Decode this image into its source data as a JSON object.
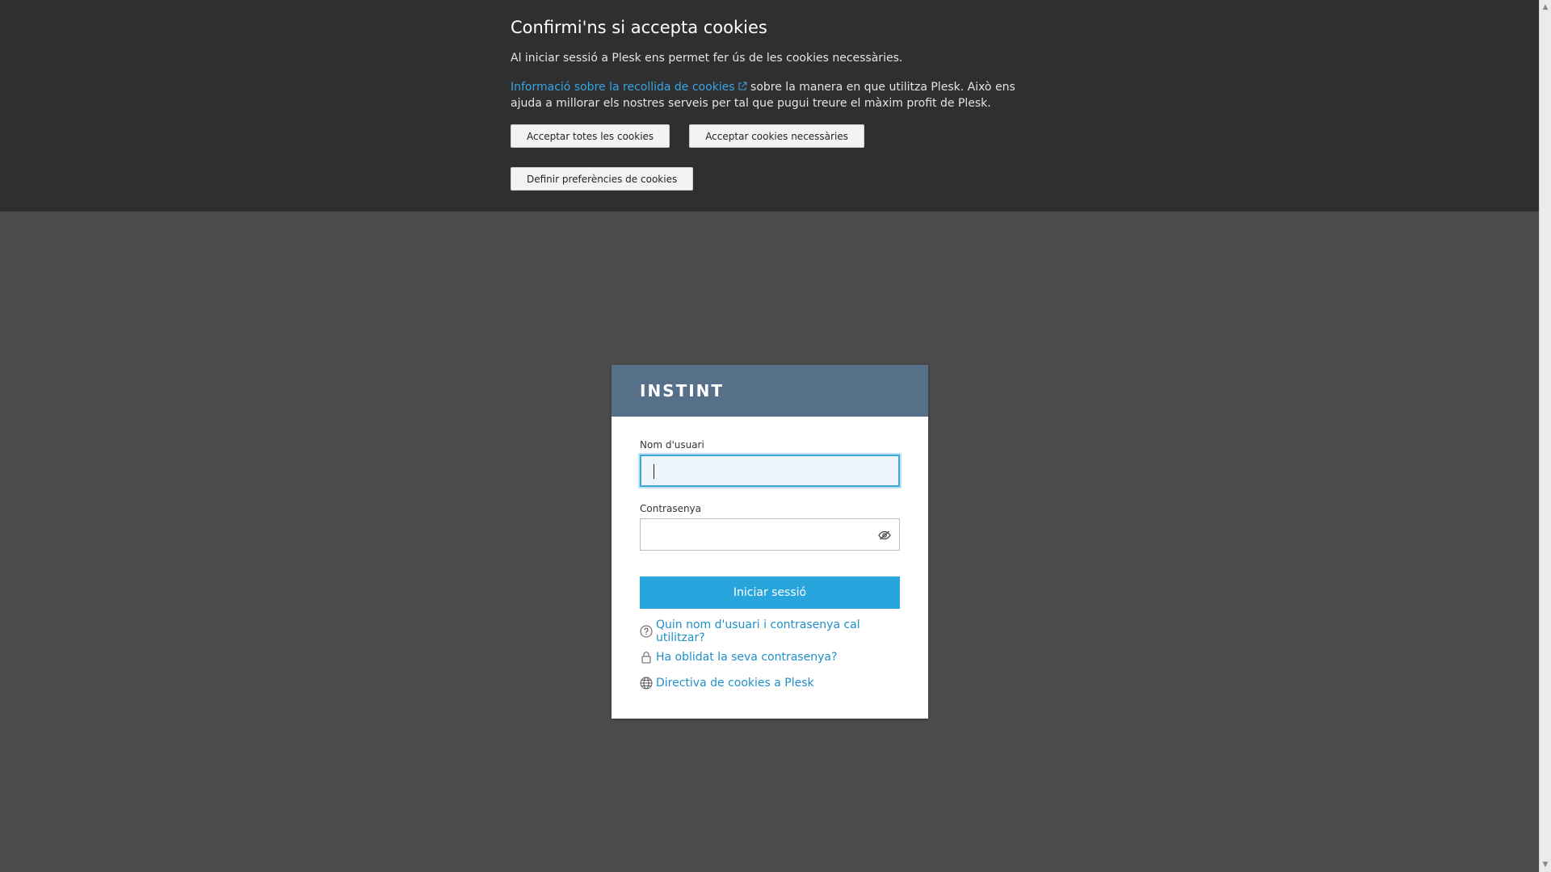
{
  "cookie_banner": {
    "title": "Confirmi'ns si accepta cookies",
    "intro": "Al iniciar sessió a Plesk ens permet fer ús de les cookies necessàries.",
    "info_link": "Informació sobre la recollida de cookies",
    "info_rest": " sobre la manera en que utilitza Plesk. Això ens ajuda a millorar els nostres serveis per tal que pugui treure el màxim profit de Plesk.",
    "accept_all": "Acceptar totes les cookies",
    "accept_necessary": "Acceptar cookies necessàries",
    "define_preferences": "Definir preferències de cookies",
    "external_icon": "external-link-icon"
  },
  "login": {
    "logo_text": "INSTINT",
    "username_label": "Nom d'usuari",
    "username_value": "",
    "password_label": "Contrasenya",
    "password_value": "",
    "password_toggle_icon": "eye-slash-icon",
    "submit_label": "Iniciar sessió",
    "links": [
      {
        "label": "Quin nom d'usuari i contrasenya cal utilitzar?",
        "icon": "question-circle-icon"
      },
      {
        "label": "Ha oblidat la seva contrasenya?",
        "icon": "lock-icon"
      },
      {
        "label": "Directiva de cookies a Plesk",
        "icon": "globe-icon"
      }
    ]
  },
  "colors": {
    "banner_bg": "#2f2f2f",
    "page_bg": "#4c4c4c",
    "card_header": "#56708a",
    "primary": "#28a5dc",
    "link": "#1f8fc8"
  }
}
